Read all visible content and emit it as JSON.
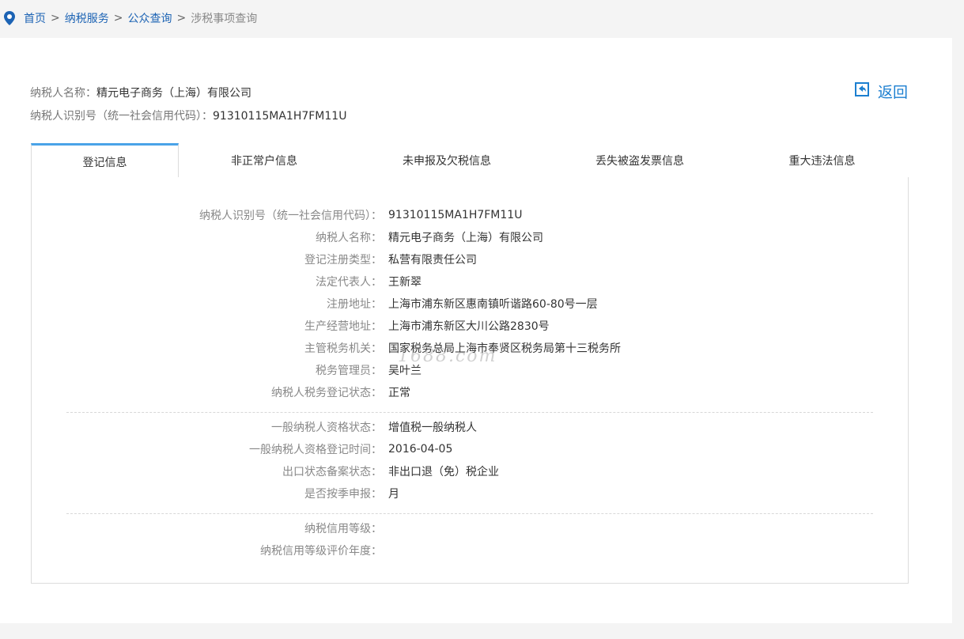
{
  "breadcrumb": {
    "items": [
      "首页",
      "纳税服务",
      "公众查询"
    ],
    "separator": ">",
    "current": "涉税事项查询"
  },
  "header": {
    "name_label": "纳税人名称：",
    "name_value": "精元电子商务（上海）有限公司",
    "id_label": "纳税人识别号（统一社会信用代码）：",
    "id_value": "91310115MA1H7FM11U",
    "back_label": "返回"
  },
  "tabs": [
    {
      "label": "登记信息",
      "active": true
    },
    {
      "label": "非正常户信息",
      "active": false
    },
    {
      "label": "未申报及欠税信息",
      "active": false
    },
    {
      "label": "丢失被盗发票信息",
      "active": false
    },
    {
      "label": "重大违法信息",
      "active": false
    }
  ],
  "registration": {
    "group1": [
      {
        "key": "纳税人识别号（统一社会信用代码）：",
        "value": "91310115MA1H7FM11U"
      },
      {
        "key": "纳税人名称：",
        "value": "精元电子商务（上海）有限公司"
      },
      {
        "key": "登记注册类型：",
        "value": "私营有限责任公司"
      },
      {
        "key": "法定代表人：",
        "value": "王新翠"
      },
      {
        "key": "注册地址：",
        "value": "上海市浦东新区惠南镇听谐路60-80号一层"
      },
      {
        "key": "生产经营地址：",
        "value": "上海市浦东新区大川公路2830号"
      },
      {
        "key": "主管税务机关：",
        "value": "国家税务总局上海市奉贤区税务局第十三税务所"
      },
      {
        "key": "税务管理员：",
        "value": "吴叶兰"
      },
      {
        "key": "纳税人税务登记状态：",
        "value": "正常"
      }
    ],
    "group2": [
      {
        "key": "一般纳税人资格状态：",
        "value": "增值税一般纳税人"
      },
      {
        "key": "一般纳税人资格登记时间：",
        "value": "2016-04-05"
      },
      {
        "key": "出口状态备案状态：",
        "value": "非出口退（免）税企业"
      },
      {
        "key": "是否按季申报：",
        "value": "月"
      }
    ],
    "group3": [
      {
        "key": "纳税信用等级：",
        "value": ""
      },
      {
        "key": "纳税信用等级评价年度：",
        "value": ""
      }
    ]
  },
  "watermark": "1688.com",
  "colors": {
    "link": "#1c63b4",
    "accent": "#4aa3e8",
    "back": "#1c7fd0"
  }
}
